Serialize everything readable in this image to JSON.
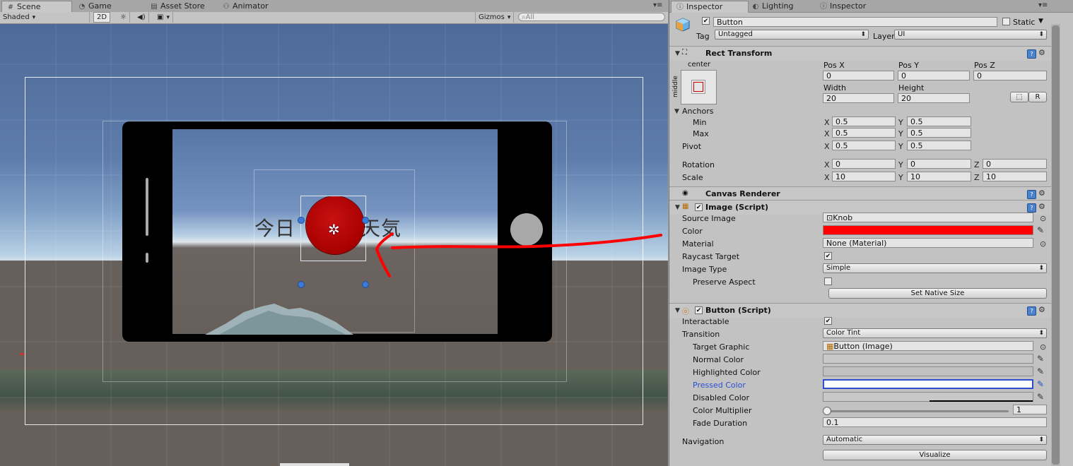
{
  "scene_panel": {
    "tabs": [
      {
        "label": "Scene",
        "icon": "grid-icon",
        "active": true
      },
      {
        "label": "Game",
        "icon": "pacman-icon",
        "active": false
      },
      {
        "label": "Asset Store",
        "icon": "store-icon",
        "active": false
      },
      {
        "label": "Animator",
        "icon": "animator-icon",
        "active": false
      }
    ],
    "toolbar": {
      "shading": "Shaded",
      "mode_2d": "2D",
      "gizmos": "Gizmos",
      "search_placeholder": "All"
    },
    "scene_text": "今日",
    "scene_text_right": "天気"
  },
  "inspector_panel": {
    "tabs": [
      {
        "label": "Inspector",
        "icon": "info-icon",
        "active": true
      },
      {
        "label": "Lighting",
        "icon": "lighting-icon",
        "active": false
      },
      {
        "label": "Inspector",
        "icon": "info-icon",
        "active": false
      }
    ],
    "object": {
      "active": true,
      "name": "Button",
      "static_label": "Static",
      "tag_label": "Tag",
      "tag": "Untagged",
      "layer_label": "Layer",
      "layer": "UI"
    },
    "rect_transform": {
      "title": "Rect Transform",
      "anchor_h": "center",
      "anchor_v": "middle",
      "pos_x_label": "Pos X",
      "pos_y_label": "Pos Y",
      "pos_z_label": "Pos Z",
      "pos_x": "0",
      "pos_y": "0",
      "pos_z": "0",
      "width_label": "Width",
      "height_label": "Height",
      "width": "20",
      "height": "20",
      "r_button": "R",
      "anchors_label": "Anchors",
      "min_label": "Min",
      "min_x": "0.5",
      "min_y": "0.5",
      "max_label": "Max",
      "max_x": "0.5",
      "max_y": "0.5",
      "pivot_label": "Pivot",
      "pivot_x": "0.5",
      "pivot_y": "0.5",
      "rotation_label": "Rotation",
      "rot_x": "0",
      "rot_y": "0",
      "rot_z": "0",
      "scale_label": "Scale",
      "scale_x": "10",
      "scale_y": "10",
      "scale_z": "10",
      "x": "X",
      "y": "Y",
      "z": "Z"
    },
    "canvas_renderer": {
      "title": "Canvas Renderer"
    },
    "image": {
      "title": "Image (Script)",
      "enabled": true,
      "source_image_label": "Source Image",
      "source_image": "Knob",
      "color_label": "Color",
      "color": "#ff0000",
      "material_label": "Material",
      "material": "None (Material)",
      "raycast_label": "Raycast Target",
      "raycast": true,
      "image_type_label": "Image Type",
      "image_type": "Simple",
      "preserve_label": "Preserve Aspect",
      "preserve": false,
      "set_native_size": "Set Native Size"
    },
    "button": {
      "title": "Button (Script)",
      "enabled": true,
      "interactable_label": "Interactable",
      "interactable": true,
      "transition_label": "Transition",
      "transition": "Color Tint",
      "target_graphic_label": "Target Graphic",
      "target_graphic": "Button (Image)",
      "normal_color_label": "Normal Color",
      "normal_color": "#c8c8c8",
      "highlighted_color_label": "Highlighted Color",
      "highlighted_color": "#c0c0c0",
      "pressed_color_label": "Pressed Color",
      "pressed_color": "#ffffff",
      "disabled_color_label": "Disabled Color",
      "disabled_color": "#c8c8c8",
      "multiplier_label": "Color Multiplier",
      "multiplier": "1",
      "fade_label": "Fade Duration",
      "fade": "0.1",
      "navigation_label": "Navigation",
      "navigation": "Automatic",
      "visualize": "Visualize"
    }
  }
}
